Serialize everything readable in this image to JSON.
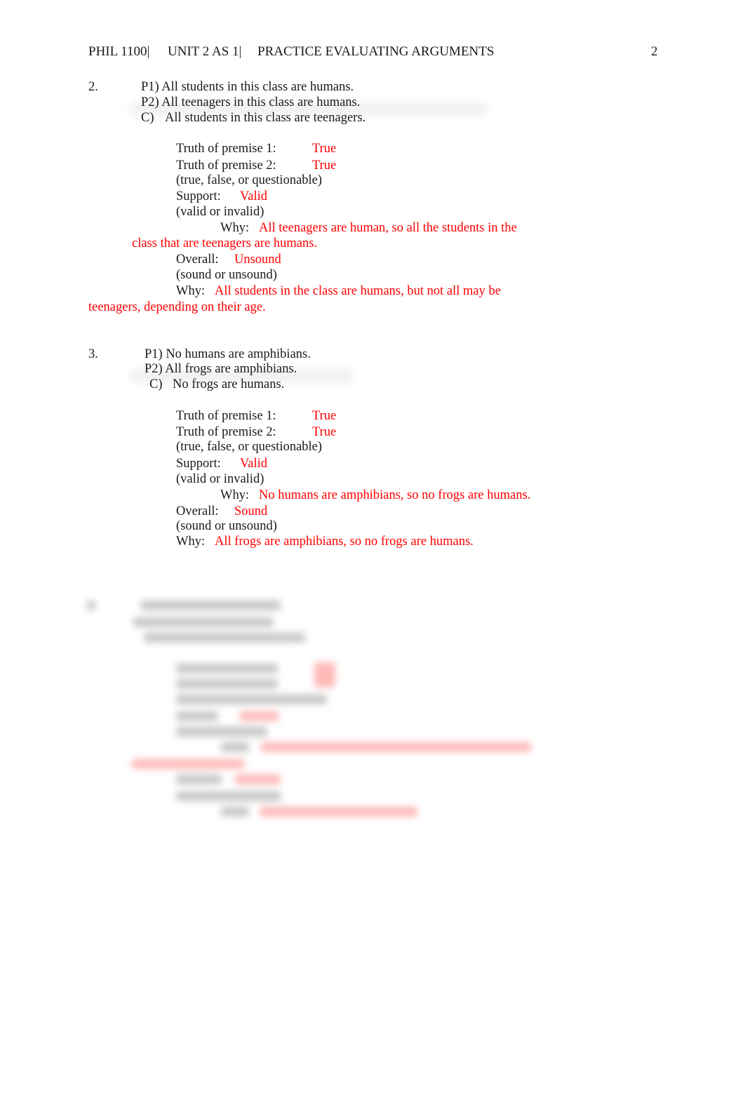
{
  "header": {
    "course": "PHIL 1100|",
    "unit": "UNIT 2 AS 1|",
    "title": "PRACTICE EVALUATING ARGUMENTS",
    "page_number": "2"
  },
  "questions": [
    {
      "number": "2.",
      "p1": "P1) All students in this class are humans.",
      "p2": "P2) All teenagers in this class are humans.",
      "c_label": "C)",
      "c_text": "All students in this class are teenagers.",
      "truth_p1_label": "Truth of premise 1:",
      "truth_p1_value": "True",
      "truth_p2_label": "Truth of premise 2:",
      "truth_p2_value": "True",
      "truth_hint": "(true, false, or questionable)",
      "support_label": "Support:",
      "support_value": "Valid",
      "support_hint": "(valid or invalid)",
      "support_why_label": "Why:",
      "support_why_line1": "All teenagers are human, so all the students in the",
      "support_why_line2": "class that are teenagers are humans.",
      "overall_label": "Overall:",
      "overall_value": "Unsound",
      "overall_hint": "(sound or unsound)",
      "overall_why_label": "Why:",
      "overall_why_line1": "All students in the class are humans, but not all may be",
      "overall_why_line2": "teenagers, depending on their age."
    },
    {
      "number": "3.",
      "p1": "P1) No humans are amphibians.",
      "p2": "P2) All frogs are amphibians.",
      "c_label": "C)",
      "c_text": "No frogs are humans.",
      "truth_p1_label": "Truth of premise 1:",
      "truth_p1_value": "True",
      "truth_p2_label": "Truth of premise 2:",
      "truth_p2_value": "True",
      "truth_hint": "(true, false, or questionable)",
      "support_label": "Support:",
      "support_value": "Valid",
      "support_hint": "(valid or invalid)",
      "support_why_label": "Why:",
      "support_why_line1": "No humans are amphibians, so no frogs are humans.",
      "overall_label": "Overall:",
      "overall_value": "Sound",
      "overall_hint": "(sound or unsound)",
      "overall_why_label": "Why:",
      "overall_why_line1": "All frogs are amphibians, so no frogs are humans."
    }
  ],
  "colors": {
    "answer": "#ff0000",
    "text": "#1a1a1a"
  }
}
